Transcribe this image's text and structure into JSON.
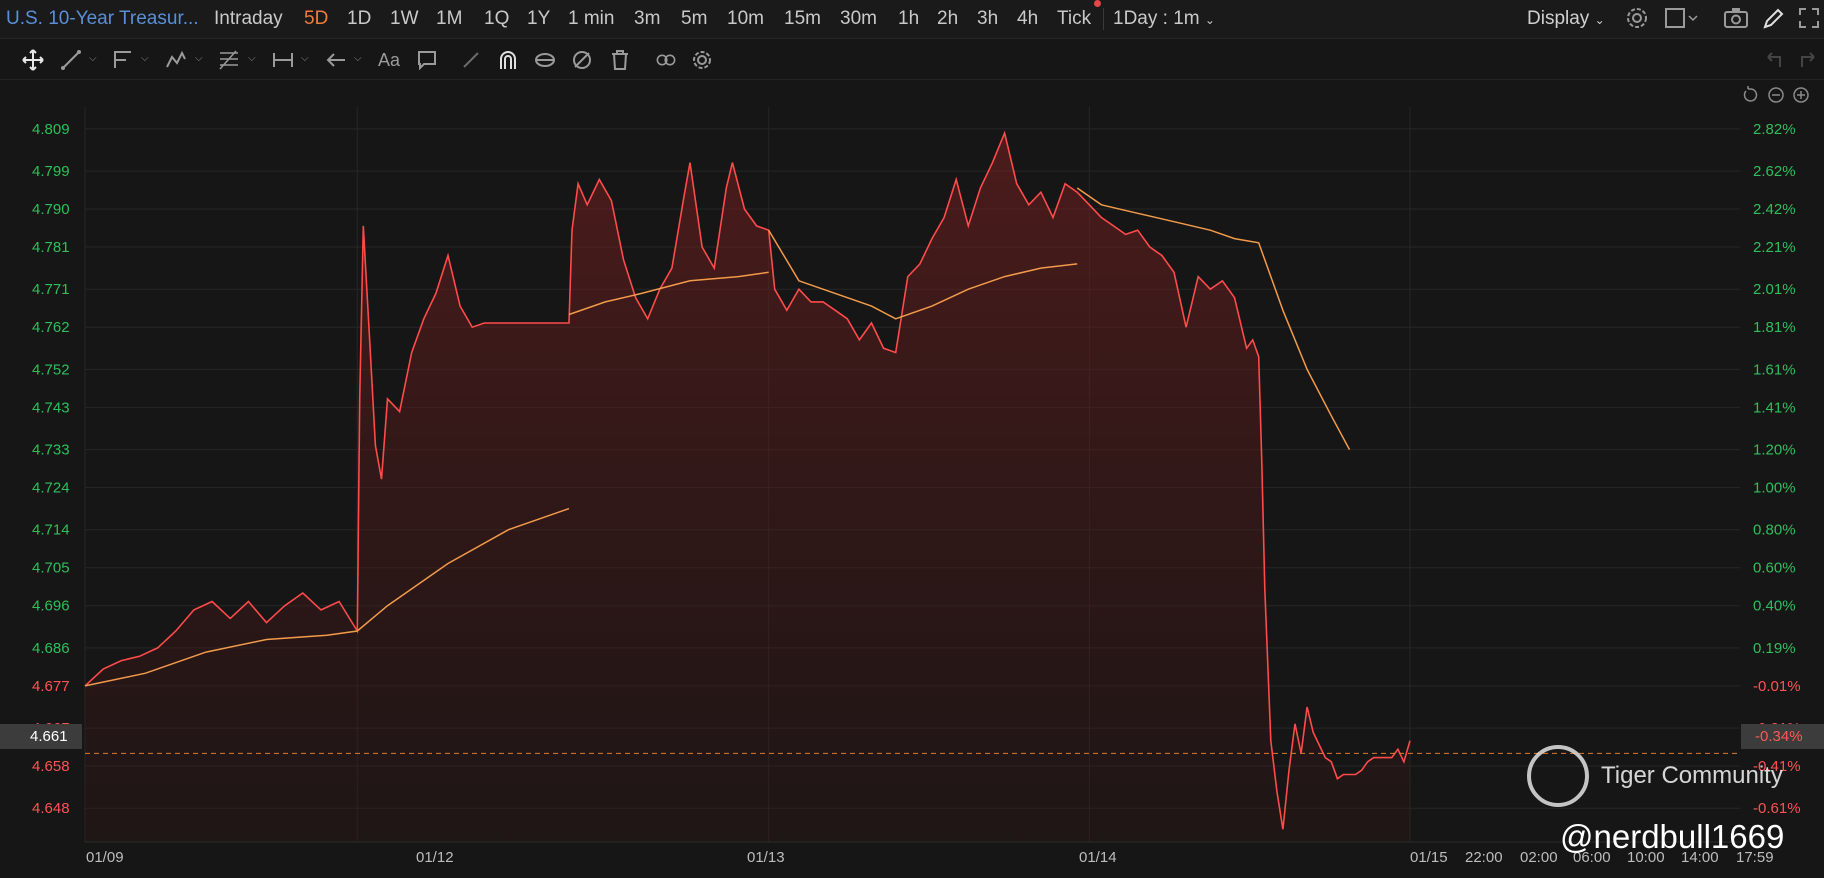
{
  "header": {
    "title": "U.S. 10-Year Treasur...",
    "timeframes": [
      "Intraday",
      "5D",
      "1D",
      "1W",
      "1M",
      "1Q",
      "1Y",
      "1 min",
      "3m",
      "5m",
      "10m",
      "15m",
      "30m",
      "1h",
      "2h",
      "3h",
      "4h",
      "Tick"
    ],
    "active_timeframe": "5D",
    "interval": "1Day : 1m",
    "display_label": "Display"
  },
  "toolbar": {
    "tools": [
      "move-icon",
      "line-icon",
      "pen-icon",
      "pattern-icon",
      "fib-icon",
      "measure-icon",
      "arrow-icon",
      "text-icon",
      "comment-icon",
      "eraser-icon",
      "magnet-icon",
      "lock-icon",
      "hide-icon",
      "trash-icon",
      "link-icon",
      "settings-icon"
    ],
    "text_tool_label": "Aa"
  },
  "colors": {
    "price_line": "#ff4a4a",
    "ma_line": "#f39a4a",
    "up_axis": "#2fbf5a",
    "down_axis": "#ff5252",
    "dashed_current": "#e07a30",
    "background": "#161616"
  },
  "current": {
    "price_label": "4.661",
    "pct_label": "-0.34%"
  },
  "watermark": {
    "brand": "Tiger Community",
    "user": "@nerdbull1669"
  },
  "chart_data": {
    "type": "line",
    "title": "U.S. 10-Year Treasur...",
    "x_ticks": [
      "01/09",
      "01/12",
      "01/13",
      "01/14",
      "01/15",
      "22:00",
      "02:00",
      "06:00",
      "10:00",
      "14:00",
      "17:59"
    ],
    "y_ticks_left": [
      "4.809",
      "4.799",
      "4.790",
      "4.781",
      "4.771",
      "4.762",
      "4.752",
      "4.743",
      "4.733",
      "4.724",
      "4.714",
      "4.705",
      "4.696",
      "4.686",
      "4.677",
      "4.667",
      "4.658",
      "4.648"
    ],
    "y_ticks_right": [
      "2.82%",
      "2.62%",
      "2.42%",
      "2.21%",
      "2.01%",
      "1.81%",
      "1.61%",
      "1.41%",
      "1.20%",
      "1.00%",
      "0.80%",
      "0.60%",
      "0.40%",
      "0.19%",
      "-0.01%",
      "-0.21%",
      "-0.41%",
      "-0.61%"
    ],
    "ylim": [
      4.64,
      4.813
    ],
    "prev_close": 4.677,
    "current_price": 4.661,
    "series": [
      {
        "name": "",
        "kind": "price",
        "points": [
          [
            0,
            4.677
          ],
          [
            3,
            4.681
          ],
          [
            6,
            4.683
          ],
          [
            9,
            4.684
          ],
          [
            12,
            4.686
          ],
          [
            15,
            4.69
          ],
          [
            18,
            4.695
          ],
          [
            21,
            4.697
          ],
          [
            24,
            4.693
          ],
          [
            27,
            4.697
          ],
          [
            30,
            4.692
          ],
          [
            33,
            4.696
          ],
          [
            36,
            4.699
          ],
          [
            39,
            4.695
          ],
          [
            42,
            4.697
          ],
          [
            45,
            4.69
          ],
          [
            45.4,
            4.745
          ],
          [
            46,
            4.786
          ],
          [
            47,
            4.76
          ],
          [
            48,
            4.734
          ],
          [
            49,
            4.726
          ],
          [
            50,
            4.745
          ],
          [
            52,
            4.742
          ],
          [
            54,
            4.756
          ],
          [
            56,
            4.764
          ],
          [
            58,
            4.77
          ],
          [
            60,
            4.779
          ],
          [
            62,
            4.767
          ],
          [
            64,
            4.762
          ],
          [
            66,
            4.763
          ],
          [
            70,
            4.763
          ],
          [
            74,
            4.763
          ],
          [
            78,
            4.763
          ],
          [
            80,
            4.763
          ],
          [
            80.5,
            4.785
          ],
          [
            81.5,
            4.796
          ],
          [
            83,
            4.791
          ],
          [
            85,
            4.797
          ],
          [
            87,
            4.792
          ],
          [
            89,
            4.778
          ],
          [
            91,
            4.769
          ],
          [
            93,
            4.764
          ],
          [
            95,
            4.771
          ],
          [
            97,
            4.776
          ],
          [
            99,
            4.793
          ],
          [
            100,
            4.801
          ],
          [
            102,
            4.781
          ],
          [
            104,
            4.776
          ],
          [
            106,
            4.795
          ],
          [
            107,
            4.801
          ],
          [
            109,
            4.79
          ],
          [
            111,
            4.786
          ],
          [
            113,
            4.785
          ],
          [
            114,
            4.771
          ],
          [
            116,
            4.766
          ],
          [
            118,
            4.771
          ],
          [
            120,
            4.768
          ],
          [
            122,
            4.768
          ],
          [
            124,
            4.766
          ],
          [
            126,
            4.764
          ],
          [
            128,
            4.759
          ],
          [
            130,
            4.763
          ],
          [
            132,
            4.757
          ],
          [
            134,
            4.756
          ],
          [
            136,
            4.774
          ],
          [
            138,
            4.777
          ],
          [
            140,
            4.783
          ],
          [
            142,
            4.788
          ],
          [
            144,
            4.797
          ],
          [
            146,
            4.786
          ],
          [
            148,
            4.795
          ],
          [
            150,
            4.801
          ],
          [
            152,
            4.808
          ],
          [
            154,
            4.796
          ],
          [
            156,
            4.791
          ],
          [
            158,
            4.794
          ],
          [
            160,
            4.788
          ],
          [
            162,
            4.796
          ],
          [
            164,
            4.794
          ],
          [
            166,
            4.791
          ],
          [
            168,
            4.788
          ],
          [
            170,
            4.786
          ],
          [
            172,
            4.784
          ],
          [
            174,
            4.785
          ],
          [
            176,
            4.781
          ],
          [
            178,
            4.779
          ],
          [
            180,
            4.775
          ],
          [
            182,
            4.762
          ],
          [
            184,
            4.774
          ],
          [
            186,
            4.771
          ],
          [
            188,
            4.773
          ],
          [
            190,
            4.769
          ],
          [
            192,
            4.757
          ],
          [
            193,
            4.759
          ],
          [
            194,
            4.755
          ],
          [
            194.5,
            4.73
          ],
          [
            195,
            4.7
          ],
          [
            196,
            4.664
          ],
          [
            197,
            4.652
          ],
          [
            198,
            4.643
          ],
          [
            199,
            4.657
          ],
          [
            200,
            4.668
          ],
          [
            201,
            4.661
          ],
          [
            202,
            4.672
          ],
          [
            203,
            4.666
          ],
          [
            204,
            4.663
          ],
          [
            205,
            4.66
          ],
          [
            206,
            4.659
          ],
          [
            207,
            4.655
          ],
          [
            208,
            4.656
          ],
          [
            209,
            4.656
          ],
          [
            210,
            4.656
          ],
          [
            211,
            4.657
          ],
          [
            212,
            4.659
          ],
          [
            213,
            4.66
          ],
          [
            214,
            4.66
          ],
          [
            215,
            4.66
          ],
          [
            216,
            4.66
          ],
          [
            217,
            4.662
          ],
          [
            218,
            4.659
          ],
          [
            219,
            4.664
          ]
        ]
      },
      {
        "name": "",
        "kind": "average",
        "segments": [
          [
            [
              0,
              4.677
            ],
            [
              10,
              4.68
            ],
            [
              20,
              4.685
            ],
            [
              30,
              4.688
            ],
            [
              40,
              4.689
            ],
            [
              45,
              4.69
            ],
            [
              50,
              4.696
            ],
            [
              60,
              4.706
            ],
            [
              70,
              4.714
            ],
            [
              80,
              4.719
            ]
          ],
          [
            [
              80,
              4.765
            ],
            [
              86,
              4.768
            ],
            [
              92,
              4.77
            ],
            [
              100,
              4.773
            ],
            [
              108,
              4.774
            ],
            [
              113,
              4.775
            ]
          ],
          [
            [
              113,
              4.785
            ],
            [
              118,
              4.773
            ],
            [
              124,
              4.77
            ],
            [
              130,
              4.767
            ],
            [
              134,
              4.764
            ],
            [
              140,
              4.767
            ],
            [
              146,
              4.771
            ],
            [
              152,
              4.774
            ],
            [
              158,
              4.776
            ],
            [
              164,
              4.777
            ]
          ],
          [
            [
              164,
              4.795
            ],
            [
              168,
              4.791
            ],
            [
              174,
              4.789
            ],
            [
              180,
              4.787
            ],
            [
              186,
              4.785
            ],
            [
              190,
              4.783
            ],
            [
              194,
              4.782
            ],
            [
              198,
              4.766
            ],
            [
              202,
              4.752
            ],
            [
              206,
              4.741
            ],
            [
              209,
              4.733
            ]
          ]
        ]
      }
    ],
    "grid": true,
    "legend": "none"
  }
}
